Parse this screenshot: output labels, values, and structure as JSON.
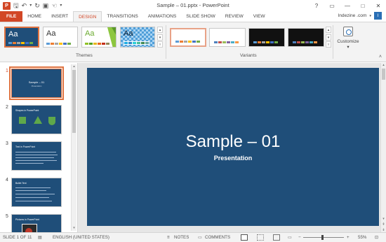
{
  "titlebar": {
    "title": "Sample – 01.pptx - PowerPoint",
    "app_icon_letter": "P",
    "help": "?",
    "minimize": "—",
    "maximize": "□",
    "close": "✕"
  },
  "tabs": [
    {
      "label": "FILE"
    },
    {
      "label": "HOME"
    },
    {
      "label": "INSERT"
    },
    {
      "label": "DESIGN"
    },
    {
      "label": "TRANSITIONS"
    },
    {
      "label": "ANIMATIONS"
    },
    {
      "label": "SLIDE SHOW"
    },
    {
      "label": "REVIEW"
    },
    {
      "label": "VIEW"
    }
  ],
  "active_tab": "DESIGN",
  "account": {
    "name": "Indezine .com",
    "avatar_letter": "I"
  },
  "ribbon": {
    "themes_label": "Themes",
    "variants_label": "Variants",
    "customize_label": "Customize",
    "customize_arrow": "▾",
    "themes": [
      {
        "aa": "Aa"
      },
      {
        "aa": "Aa"
      },
      {
        "aa": "Aa"
      },
      {
        "aa": "Aa"
      }
    ],
    "collapse": "˄"
  },
  "thumbnails": [
    {
      "number": "1",
      "title": "Sample – 01",
      "subtitle": "Presentation"
    },
    {
      "number": "2",
      "title": "Shapes in PowerPoint"
    },
    {
      "number": "3",
      "title": "Text in PowerPoint"
    },
    {
      "number": "4",
      "title": "Bullet Text"
    },
    {
      "number": "5",
      "title": "Pictures in PowerPoint"
    }
  ],
  "slide": {
    "title": "Sample – 01",
    "subtitle": "Presentation"
  },
  "status": {
    "slide_count": "SLIDE 1 OF 11",
    "language": "ENGLISH (UNITED STATES)",
    "notes": "NOTES",
    "comments": "COMMENTS",
    "zoom_minus": "−",
    "zoom_plus": "+",
    "zoom_level": "55%"
  },
  "colors": {
    "accent": "#d24726",
    "slide_bg": "#1f4e79"
  }
}
